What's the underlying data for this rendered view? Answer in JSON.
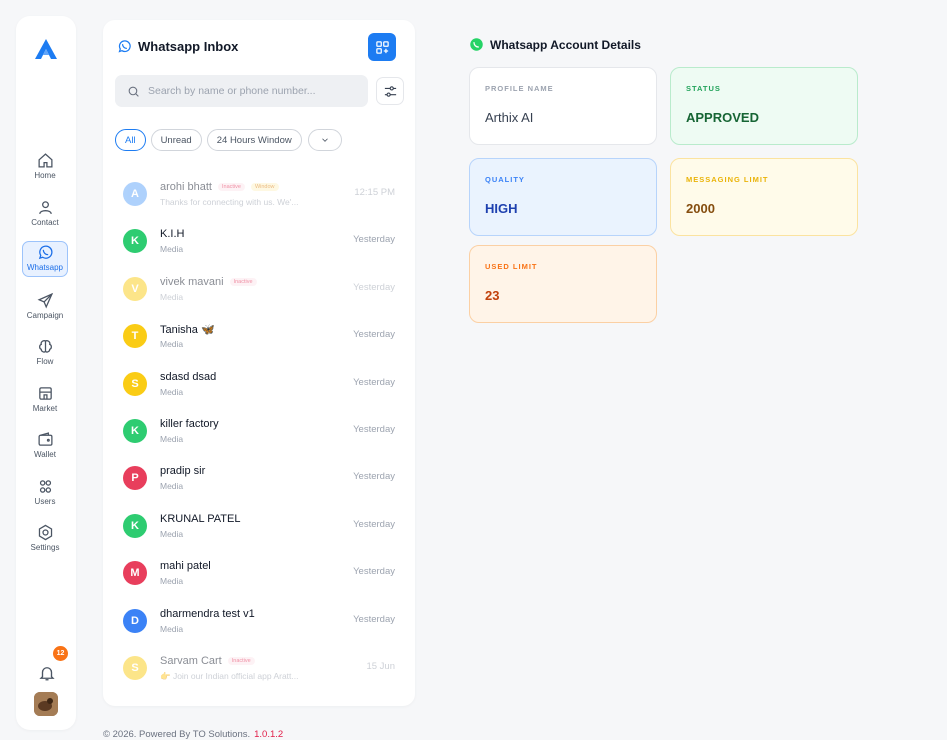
{
  "sidebar": {
    "items": [
      {
        "label": "Home",
        "icon": "home-icon"
      },
      {
        "label": "Contact",
        "icon": "user-icon"
      },
      {
        "label": "Whatsapp",
        "icon": "whatsapp-icon",
        "active": true
      },
      {
        "label": "Campaign",
        "icon": "send-icon"
      },
      {
        "label": "Flow",
        "icon": "brain-icon"
      },
      {
        "label": "Market",
        "icon": "store-icon"
      },
      {
        "label": "Wallet",
        "icon": "wallet-icon"
      },
      {
        "label": "Users",
        "icon": "users-icon"
      },
      {
        "label": "Settings",
        "icon": "gear-icon"
      }
    ],
    "notification_count": "12"
  },
  "inbox": {
    "title": "Whatsapp Inbox",
    "search_placeholder": "Search by name or phone number...",
    "filters": [
      "All",
      "Unread",
      "24 Hours Window"
    ],
    "conversations": [
      {
        "initial": "A",
        "name": "arohi bhatt",
        "preview": "Thanks for connecting with us. We'...",
        "time": "12:15 PM",
        "color": "#60a5fa",
        "tag": "Inactive",
        "tag2": "Window",
        "faded": true
      },
      {
        "initial": "K",
        "name": "K.I.H",
        "preview": "Media",
        "time": "Yesterday",
        "color": "#2ecc71"
      },
      {
        "initial": "V",
        "name": "vivek mavani",
        "preview": "Media",
        "time": "Yesterday",
        "color": "#facc15",
        "tag": "Inactive",
        "faded": true
      },
      {
        "initial": "T",
        "name": "Tanisha 🦋",
        "preview": "Media",
        "time": "Yesterday",
        "color": "#facc15"
      },
      {
        "initial": "S",
        "name": "sdasd dsad",
        "preview": "Media",
        "time": "Yesterday",
        "color": "#facc15"
      },
      {
        "initial": "K",
        "name": "killer factory",
        "preview": "Media",
        "time": "Yesterday",
        "color": "#2ecc71"
      },
      {
        "initial": "P",
        "name": "pradip sir",
        "preview": "Media",
        "time": "Yesterday",
        "color": "#e83e5c"
      },
      {
        "initial": "K",
        "name": "KRUNAL PATEL",
        "preview": "Media",
        "time": "Yesterday",
        "color": "#2ecc71"
      },
      {
        "initial": "M",
        "name": "mahi patel",
        "preview": "Media",
        "time": "Yesterday",
        "color": "#e83e5c"
      },
      {
        "initial": "D",
        "name": "dharmendra test v1",
        "preview": "Media",
        "time": "Yesterday",
        "color": "#3b82f6"
      },
      {
        "initial": "S",
        "name": "Sarvam Cart",
        "preview": "👉 Join our Indian official app Aratt...",
        "time": "15 Jun",
        "color": "#facc15",
        "tag": "Inactive",
        "faded": true
      }
    ]
  },
  "account": {
    "title": "Whatsapp Account Details",
    "profile_label": "PROFILE NAME",
    "profile_value": "Arthix AI",
    "status_label": "STATUS",
    "status_value": "APPROVED",
    "quality_label": "QUALITY",
    "quality_value": "HIGH",
    "msg_label": "MESSAGING LIMIT",
    "msg_value": "2000",
    "used_label": "USED LIMIT",
    "used_value": "23"
  },
  "footer": {
    "text": "© 2026. Powered By TO Solutions.",
    "version": "1.0.1.2"
  },
  "colors": {
    "accent": "#1d7cf2",
    "whatsapp": "#25d366"
  }
}
